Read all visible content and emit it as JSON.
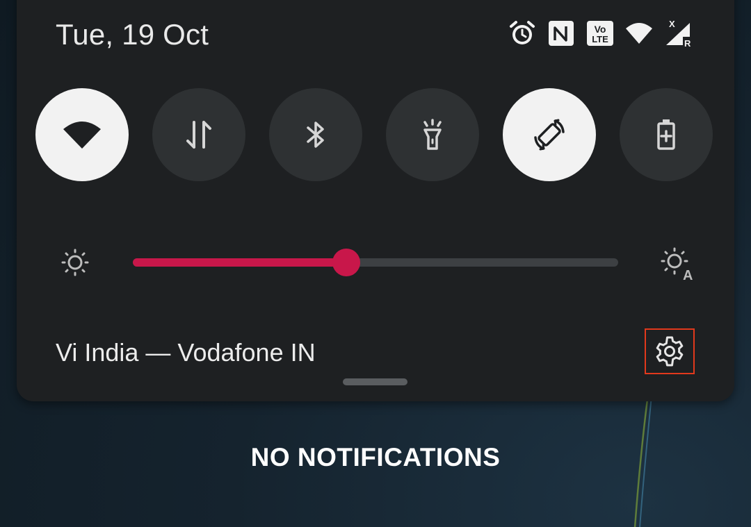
{
  "header": {
    "date": "Tue, 19 Oct",
    "status_icons": [
      "alarm-icon",
      "nfc-icon",
      "volte-icon",
      "wifi-icon",
      "cell-signal-icon"
    ],
    "volte_line1": "Vo",
    "volte_line2": "LTE",
    "signal_no_service_mark": "X",
    "signal_roaming_mark": "R"
  },
  "quick_tiles": [
    {
      "name": "wifi",
      "state": "on",
      "icon": "wifi-icon"
    },
    {
      "name": "mobile-data",
      "state": "off",
      "icon": "data-arrows-icon"
    },
    {
      "name": "bluetooth",
      "state": "off",
      "icon": "bluetooth-icon"
    },
    {
      "name": "flashlight",
      "state": "off",
      "icon": "flashlight-icon"
    },
    {
      "name": "auto-rotate",
      "state": "on",
      "icon": "rotate-icon"
    },
    {
      "name": "battery-saver",
      "state": "off",
      "icon": "battery-saver-icon"
    }
  ],
  "brightness": {
    "level_fraction": 0.44,
    "auto_icon_letter": "A"
  },
  "footer": {
    "carrier": "Vi India — Vodafone IN"
  },
  "notifications": {
    "empty_text": "NO NOTIFICATIONS"
  },
  "colors": {
    "accent": "#c8174a",
    "tile_on": "#f2f2f2",
    "tile_off": "#2e3133",
    "panel": "#1e2022",
    "highlight_box": "#e2391c"
  }
}
